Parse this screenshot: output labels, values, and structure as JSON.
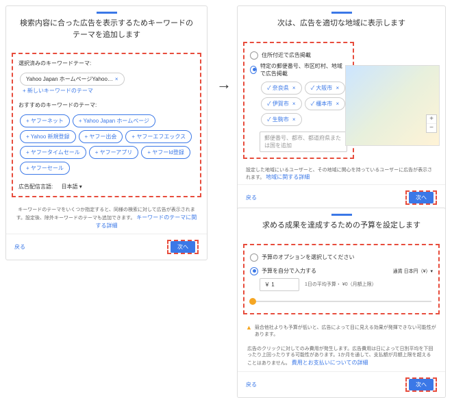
{
  "s1": {
    "title": "検索内容に合った広告を表示するためキーワードのテーマを追加します",
    "selectedLabel": "選択済みのキーワードテーマ:",
    "selectedChip": "Yahoo Japan ホームページYahoo…",
    "addLink": "+ 新しいキーワードのテーマ",
    "recLabel": "おすすめのキーワードのテーマ:",
    "rec": [
      "+ ヤフーネット",
      "+ Yahoo Japan ホームページ",
      "+ Yahoo 新規登録",
      "+ ヤフー出会",
      "+ ヤフーエフエックス",
      "+ ヤフータイムセール",
      "+ ヤフーアプリ",
      "+ ヤフーId登録",
      "+ ヤフーセール"
    ],
    "langLabel": "広告配信言語:",
    "lang": "日本語 ▾",
    "fine": "キーワードのテーマをいくつか指定すると、同様の検索に対して広告が表示されます。設定後、除外キーワードのテーマも追加できます。",
    "fineLink": "キーワードのテーマに関する詳細",
    "back": "戻る",
    "next": "次へ"
  },
  "s2": {
    "title": "次は、広告を適切な地域に表示します",
    "r1": "住所付近で広告掲載",
    "r2": "特定の郵便番号、市区町村、地域で広告掲載",
    "chips": [
      "奈良県",
      "大阪市",
      "伊賀市",
      "橿本市",
      "生駒市"
    ],
    "ph": "郵便番号、都市、都道府県または国を追加",
    "note": "設定した地域にいるユーザーと、その地域に関心を持っているユーザーに広告が表示されます。",
    "noteLink": "地域に関する詳細",
    "back": "戻る",
    "next": "次へ"
  },
  "s3": {
    "title": "求める成果を達成するための予算を設定します",
    "r1": "予算のオプションを選択してください",
    "r2": "予算を自分で入力する",
    "curLabel": "通貨",
    "cur": "日本円（¥）▾",
    "amt": "￥ 1",
    "sub": "1日の平均予算・ ¥0（月額上限）",
    "warn": "競合他社よりも予算が低いと、広告によって目に見える効果が発揮できない可能性があります。",
    "fine": "広告のクリックに対してのみ費用が発生します。広告費用は日によって日別平均を下回ったり上回ったりする可能性があります。1か月を通して、支払額が月額上限を超えることはありません。",
    "fineLink": "費用とお支払いについての詳細",
    "back": "戻る",
    "next": "次へ"
  }
}
